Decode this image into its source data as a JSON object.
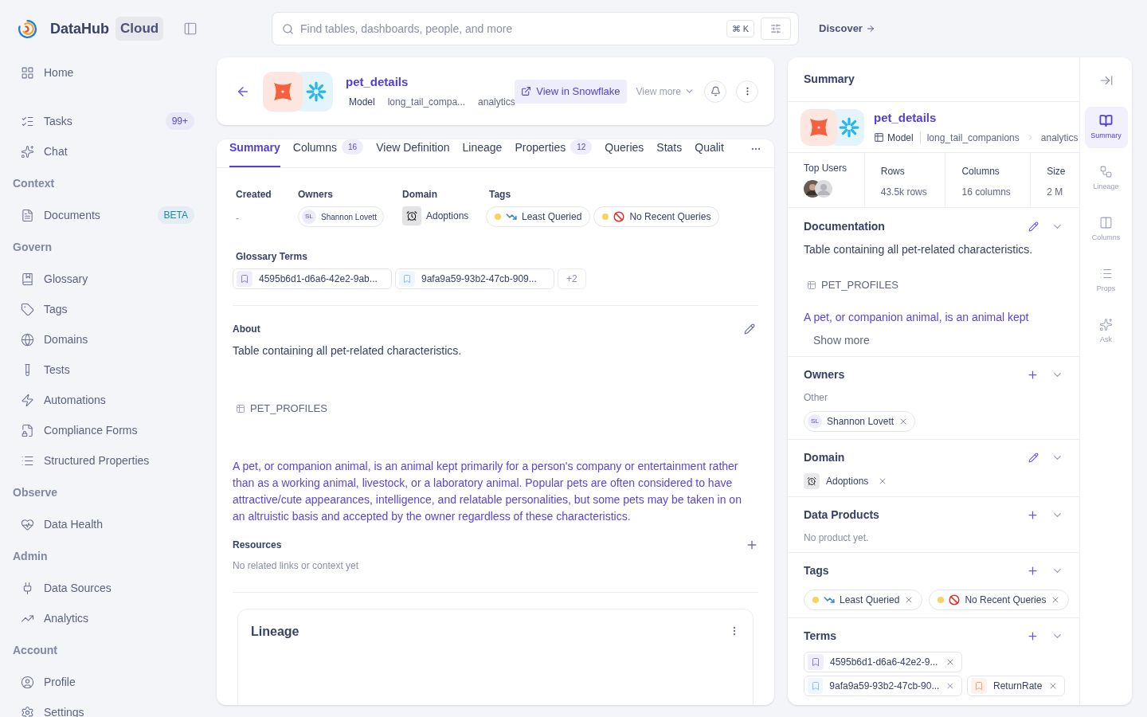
{
  "brand": {
    "name": "DataHub",
    "edition": "Cloud"
  },
  "sidebar": {
    "groups": [
      {
        "items": [
          {
            "label": "Home"
          }
        ]
      },
      {
        "items": [
          {
            "label": "Tasks",
            "badge": {
              "text": "99+",
              "color": "#5b45d9"
            }
          },
          {
            "label": "Chat"
          }
        ]
      },
      {
        "heading": "Context",
        "items": [
          {
            "label": "Documents",
            "badge": {
              "text": "BETA",
              "color": "#1b8aa6"
            }
          }
        ]
      },
      {
        "heading": "Govern",
        "items": [
          {
            "label": "Glossary"
          },
          {
            "label": "Tags"
          },
          {
            "label": "Domains"
          },
          {
            "label": "Tests"
          },
          {
            "label": "Automations"
          },
          {
            "label": "Compliance Forms"
          },
          {
            "label": "Structured Properties"
          }
        ]
      },
      {
        "heading": "Observe",
        "items": [
          {
            "label": "Data Health"
          }
        ]
      },
      {
        "heading": "Admin",
        "items": [
          {
            "label": "Data Sources"
          },
          {
            "label": "Analytics"
          }
        ]
      },
      {
        "heading": "Account",
        "items": [
          {
            "label": "Profile"
          },
          {
            "label": "Settings"
          }
        ]
      }
    ]
  },
  "search": {
    "placeholder": "Find tables, dashboards, people, and more",
    "shortcut": "⌘ K"
  },
  "discover": "Discover",
  "header": {
    "title": "pet_details",
    "type": "Model",
    "path": [
      "long_tail_compa...",
      "analytics"
    ],
    "open_button": "View in Snowflake",
    "view_more": "View more"
  },
  "tabs": [
    {
      "label": "Summary",
      "selected": true
    },
    {
      "label": "Columns",
      "count": "16",
      "selected": false
    },
    {
      "label": "View Definition",
      "selected": false
    },
    {
      "label": "Lineage",
      "selected": false
    },
    {
      "label": "Properties",
      "count": "12",
      "selected": false
    },
    {
      "label": "Queries",
      "selected": false
    },
    {
      "label": "Stats",
      "selected": false
    },
    {
      "label": "Qualit",
      "selected": false
    }
  ],
  "overview": {
    "created": {
      "label": "Created",
      "value": "-"
    },
    "owners": {
      "label": "Owners",
      "items": [
        {
          "initials": "SL",
          "name": "Shannon Lovett"
        }
      ]
    },
    "domain": {
      "label": "Domain",
      "name": "Adoptions"
    },
    "tags": {
      "label": "Tags",
      "items": [
        {
          "name": "Least Queried",
          "color": "#f8d35e"
        },
        {
          "name": "No Recent Queries",
          "color": "#f8d35e"
        }
      ]
    },
    "glossary": {
      "label": "Glossary Terms",
      "items": [
        {
          "name": "4595b6d1-d6a6-42e2-9ab...",
          "color": "#8b7be8"
        },
        {
          "name": "9afa9a59-93b2-47cb-909...",
          "color": "#8fbcf2"
        }
      ],
      "more": "+2"
    }
  },
  "about": {
    "heading": "About",
    "description": "Table containing all pet-related characteristics.",
    "table_ref": "PET_PROFILES",
    "paragraph": "A pet, or companion animal, is an animal kept primarily for a person's company or entertainment rather than as a working animal, livestock, or a laboratory animal. Popular pets are often considered to have attractive/cute appearances, intelligence, and relatable personalities, but some pets may be taken in on an altruistic basis and accepted by the owner regardless of these characteristics.",
    "resources_heading": "Resources",
    "resources_empty": "No related links or context yet"
  },
  "lineage_card": {
    "title": "Lineage"
  },
  "summary_panel": {
    "title": "Summary",
    "entity": {
      "title": "pet_details",
      "type": "Model",
      "path": [
        "long_tail_companions",
        "analytics"
      ]
    },
    "stats": [
      {
        "kind": "users",
        "label": "Top Users"
      },
      {
        "kind": "value",
        "label": "Rows",
        "value": "43.5k rows"
      },
      {
        "kind": "value",
        "label": "Columns",
        "value": "16 columns"
      },
      {
        "kind": "value",
        "label": "Size",
        "value": "2 M"
      }
    ],
    "sections": [
      {
        "kind": "documentation",
        "title": "Documentation",
        "editable": true,
        "description": "Table containing all pet-related characteristics.",
        "table_ref": "PET_PROFILES",
        "paragraph": "A pet, or companion animal, is an animal kept",
        "show_more": "Show more"
      },
      {
        "kind": "owners",
        "title": "Owners",
        "editable": false,
        "group": "Other",
        "owners": [
          {
            "initials": "SL",
            "name": "Shannon Lovett"
          }
        ]
      },
      {
        "kind": "domain",
        "title": "Domain",
        "editable": true,
        "name": "Adoptions"
      },
      {
        "kind": "empty",
        "title": "Data Products",
        "editable": false,
        "text": "No product yet."
      },
      {
        "kind": "tags",
        "title": "Tags",
        "editable": false,
        "tags": [
          {
            "name": "Least Queried",
            "color": "#f8d35e"
          },
          {
            "name": "No Recent Queries",
            "color": "#f8d35e"
          }
        ]
      },
      {
        "kind": "terms",
        "title": "Terms",
        "editable": false,
        "terms": [
          {
            "name": "4595b6d1-d6a6-42e2-9...",
            "color": "#8b7be8"
          },
          {
            "name": "9afa9a59-93b2-47cb-90...",
            "color": "#8fbcf2"
          },
          {
            "name": "ReturnRate",
            "color": "#f4a07a"
          }
        ]
      }
    ]
  },
  "rail": [
    {
      "label": "Summary",
      "selected": true
    },
    {
      "label": "Lineage",
      "selected": false
    },
    {
      "label": "Columns",
      "selected": false
    },
    {
      "label": "Props",
      "selected": false
    },
    {
      "label": "Ask",
      "selected": false
    }
  ]
}
